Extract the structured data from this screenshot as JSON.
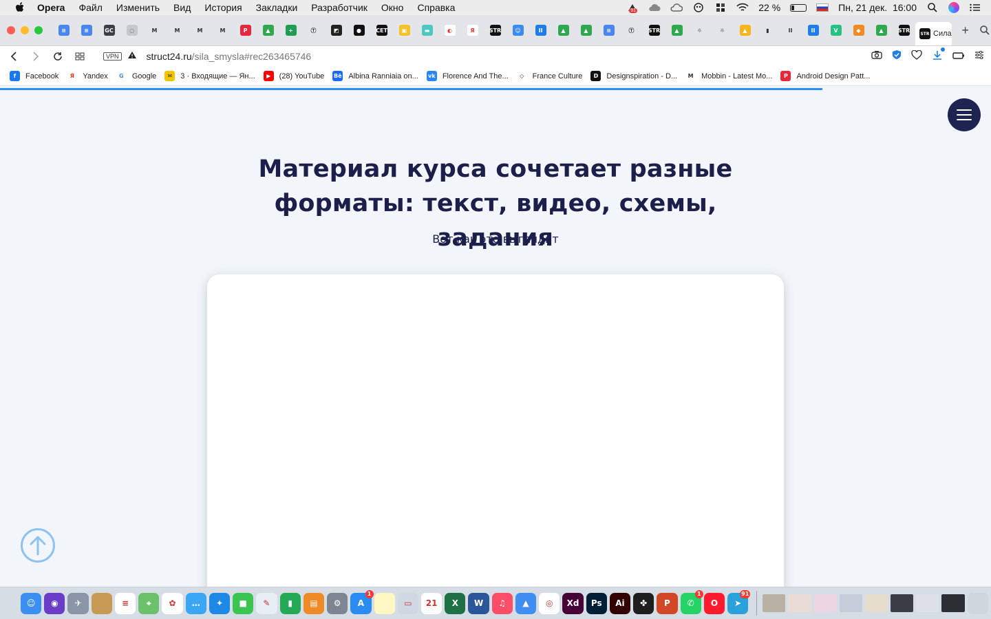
{
  "menubar": {
    "app_name": "Opera",
    "items": [
      "Файл",
      "Изменить",
      "Вид",
      "История",
      "Закладки",
      "Разработчик",
      "Окно",
      "Справка"
    ],
    "status": {
      "notification_badge": "91",
      "battery_percent": "22 %",
      "battery_level": 0.22,
      "datetime": "Пн, 21 дек.  16:00"
    }
  },
  "tabs": {
    "active_tab_title": "Сила",
    "favicons": [
      "google-docs",
      "google-docs",
      "gc",
      "loading",
      "mobbin",
      "mobbin",
      "mobbin",
      "mobbin",
      "patterns",
      "google-drive",
      "green-plus",
      "t-circle",
      "pink-square",
      "black-circle",
      "cet",
      "yellow-bag",
      "teal-bar",
      "french-flag",
      "yandex",
      "struct",
      "reddit-bot",
      "blue-pause",
      "google-drive",
      "google-drive",
      "google-docs",
      "t-circle",
      "struct",
      "google-drive",
      "lightbulb",
      "lightbulb",
      "yellow-image",
      "file",
      "pause",
      "blue-pause",
      "green-v",
      "orange-shield",
      "google-drive",
      "struct"
    ]
  },
  "address": {
    "vpn_label": "VPN",
    "domain": "struct24.ru",
    "path": "/sila_smysla#rec263465746"
  },
  "bookmarks": [
    {
      "label": "Facebook",
      "icon": "facebook-icon",
      "color": "#1877f2",
      "glyph": "f"
    },
    {
      "label": "Yandex",
      "icon": "yandex-icon",
      "color": "#ffffff",
      "glyph": "Я"
    },
    {
      "label": "Google",
      "icon": "google-icon",
      "color": "#ffffff",
      "glyph": "G"
    },
    {
      "label": "3 · Входящие — Ян...",
      "icon": "mail-icon",
      "color": "#f5c400",
      "glyph": "✉"
    },
    {
      "label": "(28) YouTube",
      "icon": "youtube-icon",
      "color": "#ff0000",
      "glyph": "▶"
    },
    {
      "label": "Albina Ranniaia on...",
      "icon": "behance-icon",
      "color": "#1769ff",
      "glyph": "Bē"
    },
    {
      "label": "Florence And The...",
      "icon": "vk-icon",
      "color": "#2787f5",
      "glyph": "vk"
    },
    {
      "label": "France Culture",
      "icon": "france-culture-icon",
      "color": "#ffffff",
      "glyph": "◇"
    },
    {
      "label": "Designspiration - D...",
      "icon": "designspiration-icon",
      "color": "#111111",
      "glyph": "D"
    },
    {
      "label": "Mobbin - Latest Mo...",
      "icon": "mobbin-icon",
      "color": "#ffffff",
      "glyph": "M"
    },
    {
      "label": "Android Design Patt...",
      "icon": "android-patterns-icon",
      "color": "#e8273c",
      "glyph": "P"
    }
  ],
  "page": {
    "headline_line1": "Материал курса сочетает разные",
    "headline_line2": "форматы: текст, видео, схемы, задания",
    "subline": "Вот как это выглядит",
    "load_progress": 0.83
  },
  "dock": {
    "apps": [
      {
        "name": "finder",
        "color": "#3b8ff0",
        "glyph": "☺"
      },
      {
        "name": "siri",
        "color": "#6a3cc8",
        "glyph": "◉"
      },
      {
        "name": "launchpad",
        "color": "#8a96a8",
        "glyph": "✈"
      },
      {
        "name": "notefile",
        "color": "#c69a52",
        "glyph": ""
      },
      {
        "name": "reminders",
        "color": "#ffffff",
        "glyph": "≡"
      },
      {
        "name": "maps",
        "color": "#6cc26a",
        "glyph": "⌖"
      },
      {
        "name": "photos",
        "color": "#ffffff",
        "glyph": "✿"
      },
      {
        "name": "messages-bubble",
        "color": "#3aa6f5",
        "glyph": "…"
      },
      {
        "name": "safari",
        "color": "#1e88e5",
        "glyph": "✦"
      },
      {
        "name": "facetime",
        "color": "#3cc451",
        "glyph": "■"
      },
      {
        "name": "preview",
        "color": "#e8eef5",
        "glyph": "✎"
      },
      {
        "name": "numbers",
        "color": "#26a957",
        "glyph": "▮"
      },
      {
        "name": "books",
        "color": "#f08a24",
        "glyph": "▤"
      },
      {
        "name": "system-preferences",
        "color": "#7c8591",
        "glyph": "⚙"
      },
      {
        "name": "app-store",
        "color": "#2a8cf0",
        "glyph": "A",
        "badge": "1"
      },
      {
        "name": "notes",
        "color": "#fff8c4",
        "glyph": ""
      },
      {
        "name": "image-capture",
        "color": "#cfd8e3",
        "glyph": "▭"
      },
      {
        "name": "calendar",
        "color": "#ffffff",
        "glyph": "21"
      },
      {
        "name": "excel",
        "color": "#1e7145",
        "glyph": "X"
      },
      {
        "name": "word",
        "color": "#2b579a",
        "glyph": "W"
      },
      {
        "name": "music",
        "color": "#fb4d68",
        "glyph": "♫"
      },
      {
        "name": "keynote",
        "color": "#3f8ef2",
        "glyph": "▲"
      },
      {
        "name": "chrome",
        "color": "#ffffff",
        "glyph": "◎"
      },
      {
        "name": "adobe-xd",
        "color": "#470137",
        "glyph": "Xd"
      },
      {
        "name": "photoshop",
        "color": "#001e36",
        "glyph": "Ps"
      },
      {
        "name": "illustrator",
        "color": "#330000",
        "glyph": "Ai"
      },
      {
        "name": "figma",
        "color": "#1e1e1e",
        "glyph": "✤"
      },
      {
        "name": "powerpoint",
        "color": "#d24726",
        "glyph": "P"
      },
      {
        "name": "whatsapp",
        "color": "#25d366",
        "glyph": "✆",
        "badge": "1"
      },
      {
        "name": "opera",
        "color": "#ff1b2d",
        "glyph": "O"
      },
      {
        "name": "telegram",
        "color": "#2aa1da",
        "glyph": "➤",
        "badge": "91"
      }
    ],
    "docs": [
      {
        "name": "doc-thumb-1",
        "color": "#b9b2a4"
      },
      {
        "name": "doc-thumb-2",
        "color": "#e9dcd6"
      },
      {
        "name": "doc-thumb-3",
        "color": "#ecd4e0"
      },
      {
        "name": "doc-thumb-4",
        "color": "#c7cdd8"
      },
      {
        "name": "doc-thumb-5",
        "color": "#e6dccb"
      },
      {
        "name": "doc-thumb-6",
        "color": "#3a3d44"
      },
      {
        "name": "doc-thumb-7",
        "color": "#dde2e8"
      },
      {
        "name": "doc-thumb-8",
        "color": "#2c2e33"
      },
      {
        "name": "trash",
        "color": "#cfd6de"
      }
    ]
  }
}
